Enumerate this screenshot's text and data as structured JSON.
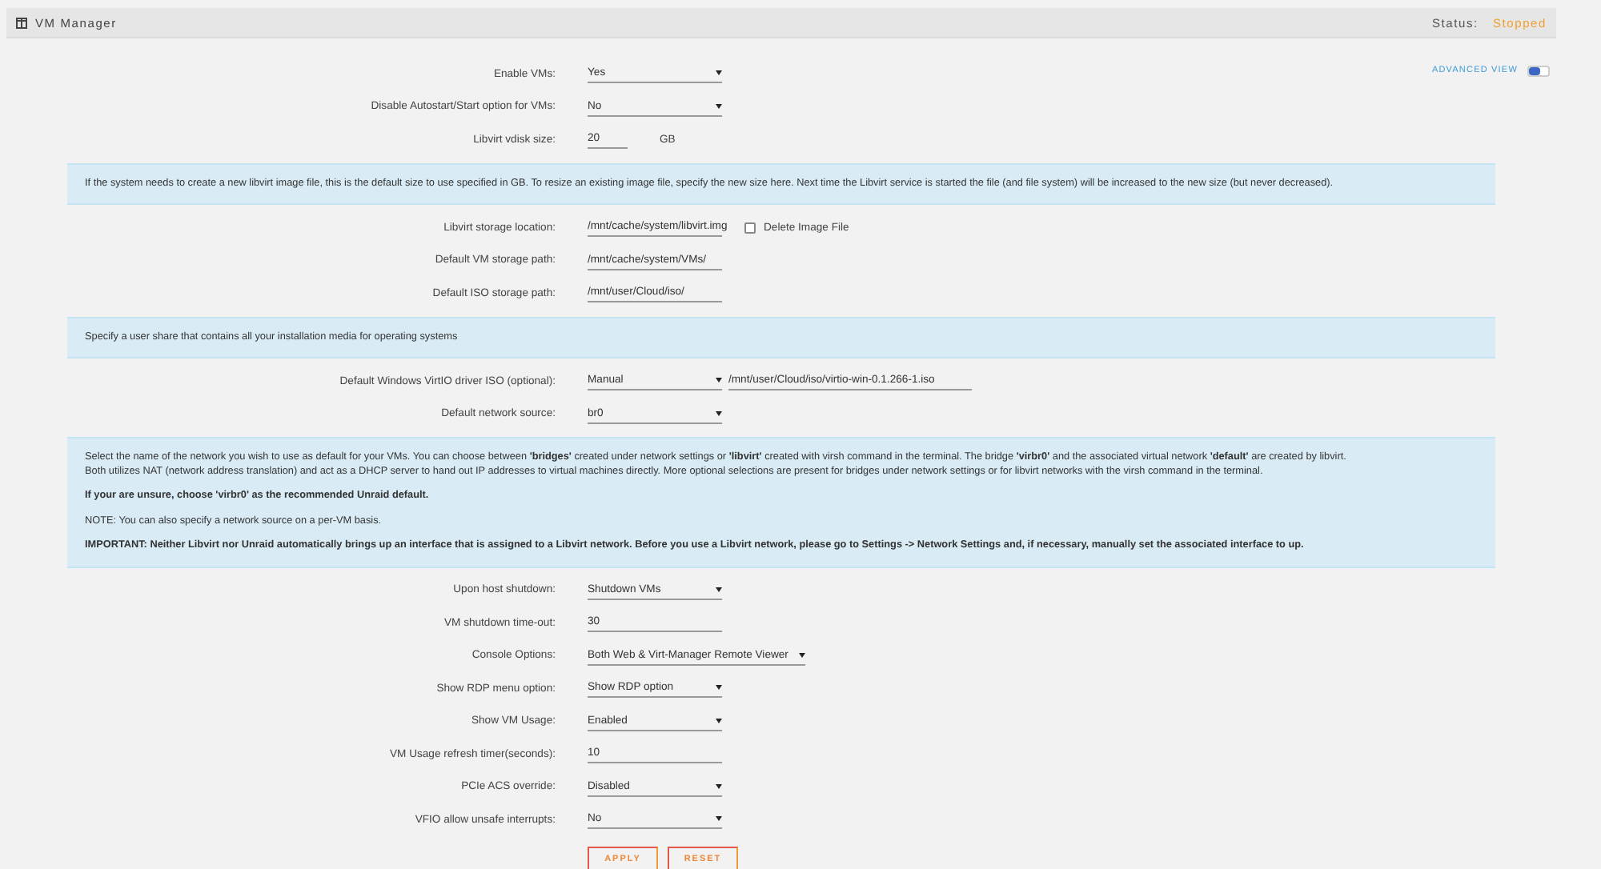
{
  "header": {
    "title": "VM Manager",
    "status_label": "Status:",
    "status_value": "Stopped"
  },
  "advanced_view": {
    "label": "ADVANCED VIEW",
    "on": true
  },
  "blocks": [
    {
      "kind": "row",
      "label": "Enable VMs:",
      "control": {
        "kind": "select",
        "value": "Yes"
      }
    },
    {
      "kind": "row",
      "label": "Disable Autostart/Start option for VMs:",
      "control": {
        "kind": "select",
        "value": "No"
      }
    },
    {
      "kind": "row",
      "label": "Libvirt vdisk size:",
      "control": {
        "kind": "short",
        "value": "20",
        "suffix": "GB"
      }
    },
    {
      "kind": "info",
      "paragraphs": [
        {
          "lines": [
            "If the system needs to create a new libvirt image file, this is the default size to use specified in GB. To resize an existing image file, specify the new size here. Next time the Libvirt service is started the file (and file system) will be increased to the new size (but never decreased)."
          ],
          "bold": false
        }
      ]
    },
    {
      "kind": "row",
      "label": "Libvirt storage location:",
      "control": {
        "kind": "input",
        "value": "/mnt/cache/system/libvirt.img"
      },
      "extra": {
        "kind": "checkbox",
        "label": "Delete Image File",
        "checked": false
      }
    },
    {
      "kind": "row",
      "label": "Default VM storage path:",
      "control": {
        "kind": "input",
        "value": "/mnt/cache/system/VMs/"
      }
    },
    {
      "kind": "row",
      "label": "Default ISO storage path:",
      "control": {
        "kind": "input",
        "value": "/mnt/user/Cloud/iso/"
      }
    },
    {
      "kind": "info",
      "paragraphs": [
        {
          "lines": [
            "Specify a user share that contains all your installation media for operating systems"
          ],
          "bold": false
        }
      ]
    },
    {
      "kind": "row",
      "label": "Default Windows VirtIO driver ISO (optional):",
      "control": {
        "kind": "select",
        "value": "Manual"
      },
      "extra": {
        "kind": "path",
        "value": "/mnt/user/Cloud/iso/virtio-win-0.1.266-1.iso"
      }
    },
    {
      "kind": "row",
      "label": "Default network source:",
      "control": {
        "kind": "select",
        "value": "br0"
      }
    },
    {
      "kind": "info",
      "paragraphs": [
        {
          "lines": [
            "Select the name of the network you wish to use as default for your VMs. You can choose between **'bridges'** created under network settings or **'libvirt'** created with virsh command in the terminal. The bridge **'virbr0'** and the associated virtual network **'default'** are created by libvirt.",
            "Both utilizes NAT (network address translation) and act as a DHCP server to hand out IP addresses to virtual machines directly. More optional selections are present for bridges under network settings or for libvirt networks with the virsh command in the terminal."
          ],
          "bold": false
        },
        {
          "lines": [
            "If your are unsure, choose 'virbr0' as the recommended Unraid default."
          ],
          "bold": true
        },
        {
          "lines": [
            "NOTE: You can also specify a network source on a per-VM basis."
          ],
          "bold": false
        },
        {
          "lines": [
            "IMPORTANT: Neither Libvirt nor Unraid automatically brings up an interface that is assigned to a Libvirt network. Before you use a Libvirt network, please go to Settings -> Network Settings and, if necessary, manually set the associated interface to up."
          ],
          "bold": true
        }
      ]
    },
    {
      "kind": "row",
      "label": "Upon host shutdown:",
      "control": {
        "kind": "select",
        "value": "Shutdown VMs"
      }
    },
    {
      "kind": "row",
      "label": "VM shutdown time-out:",
      "control": {
        "kind": "input",
        "value": "30"
      }
    },
    {
      "kind": "row",
      "label": "Console Options:",
      "control": {
        "kind": "wide-select",
        "value": "Both Web & Virt-Manager Remote Viewer"
      }
    },
    {
      "kind": "row",
      "label": "Show RDP menu option:",
      "control": {
        "kind": "select",
        "value": "Show RDP option"
      }
    },
    {
      "kind": "row",
      "label": "Show VM Usage:",
      "control": {
        "kind": "select",
        "value": "Enabled"
      }
    },
    {
      "kind": "row",
      "label": "VM Usage refresh timer(seconds):",
      "control": {
        "kind": "input",
        "value": "10"
      }
    },
    {
      "kind": "row",
      "label": "PCIe ACS override:",
      "control": {
        "kind": "select",
        "value": "Disabled"
      }
    },
    {
      "kind": "row",
      "label": "VFIO allow unsafe interrupts:",
      "control": {
        "kind": "select",
        "value": "No"
      }
    }
  ],
  "buttons": [
    "APPLY",
    "RESET"
  ]
}
